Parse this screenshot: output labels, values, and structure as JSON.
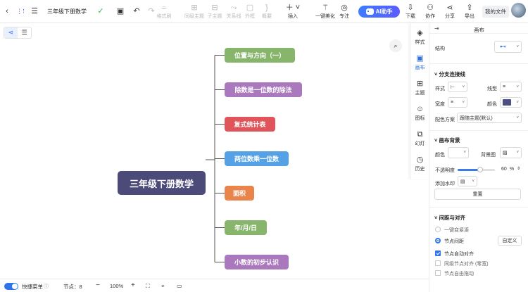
{
  "toolbar": {
    "title": "三年级下册数学",
    "format_brush": "格式刷",
    "sibling_topic": "同级主题",
    "child_topic": "子主题",
    "relation_line": "关系线",
    "boundary": "外框",
    "summary": "概要",
    "insert": "插入",
    "beautify": "一键美化",
    "focus": "专注",
    "ai_label": "AI助手",
    "download": "下载",
    "collab": "协作",
    "share": "分享",
    "export": "导出",
    "my_files": "我的文件"
  },
  "mindmap": {
    "root": "三年级下册数学",
    "branches": [
      {
        "label": "位置与方向（一）",
        "color": "#87b56b"
      },
      {
        "label": "除数是一位数的除法",
        "color": "#a978bd"
      },
      {
        "label": "复式统计表",
        "color": "#e0555b"
      },
      {
        "label": "两位数乘一位数",
        "color": "#55a1e6"
      },
      {
        "label": "面积",
        "color": "#e9844a"
      },
      {
        "label": "年/月/日",
        "color": "#87b56b"
      },
      {
        "label": "小数的初步认识",
        "color": "#a978bd"
      }
    ],
    "root_color": "#4b4a78",
    "line_color": "#555555"
  },
  "side_tabs": [
    "样式",
    "画布",
    "主题",
    "图标",
    "幻灯",
    "历史"
  ],
  "panel": {
    "title": "画布",
    "structure_label": "结构",
    "branch_section": "分支连接线",
    "style_label": "样式",
    "line_type_label": "线型",
    "width_label": "宽度",
    "color_label": "颜色",
    "branch_color": "#4b4f86",
    "scheme_label": "配色方案",
    "scheme_value": "跟随主题(默认)",
    "bg_section": "画布背景",
    "bg_color_label": "颜色",
    "bg_image_label": "背景图",
    "opacity_label": "不透明度",
    "opacity_value": "60",
    "opacity_unit": "%",
    "watermark_label": "添加水印",
    "reset_label": "重置",
    "spacing_section": "间距与对齐",
    "opt_compact": "一键变紧凑",
    "opt_node_spacing": "节点间距",
    "custom_label": "自定义",
    "chk_auto_align": "节点自动对齐",
    "chk_same_level": "同级节点对齐 (零宽)",
    "chk_free_drag": "节点自由拖动"
  },
  "status": {
    "shortcut_label": "快捷菜单",
    "node_count": "节点：8",
    "zoom": "100%"
  }
}
